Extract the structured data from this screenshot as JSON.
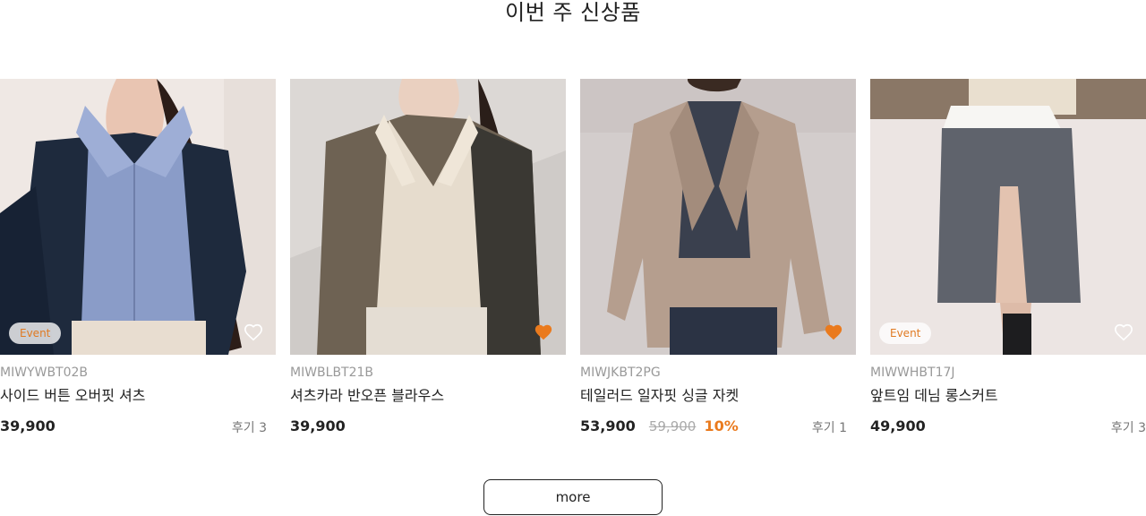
{
  "section": {
    "title": "이번 주 신상품"
  },
  "products": [
    {
      "code": "MIWYWBT02B",
      "name": "사이드 버튼 오버핏 셔츠",
      "price": "39,900",
      "original_price": "",
      "discount": "",
      "review": "후기 3",
      "badge": "Event",
      "wish": "outline"
    },
    {
      "code": "MIWBLBT21B",
      "name": "셔츠카라 반오픈 블라우스",
      "price": "39,900",
      "original_price": "",
      "discount": "",
      "review": "",
      "badge": "",
      "wish": "filled"
    },
    {
      "code": "MIWJKBT2PG",
      "name": "테일러드 일자핏 싱글 자켓",
      "price": "53,900",
      "original_price": "59,900",
      "discount": "10%",
      "review": "후기 1",
      "badge": "",
      "wish": "filled"
    },
    {
      "code": "MIWWHBT17J",
      "name": "앞트임 데님 롱스커트",
      "price": "49,900",
      "original_price": "",
      "discount": "",
      "review": "후기 3",
      "badge": "Event",
      "wish": "outline"
    }
  ],
  "more": {
    "label": "more"
  },
  "colors": {
    "accent": "#ea7a1d",
    "text": "#222222",
    "muted": "#999999"
  },
  "icons": {
    "wish_filled": "heart-filled-icon",
    "wish_outline": "heart-outline-icon"
  }
}
